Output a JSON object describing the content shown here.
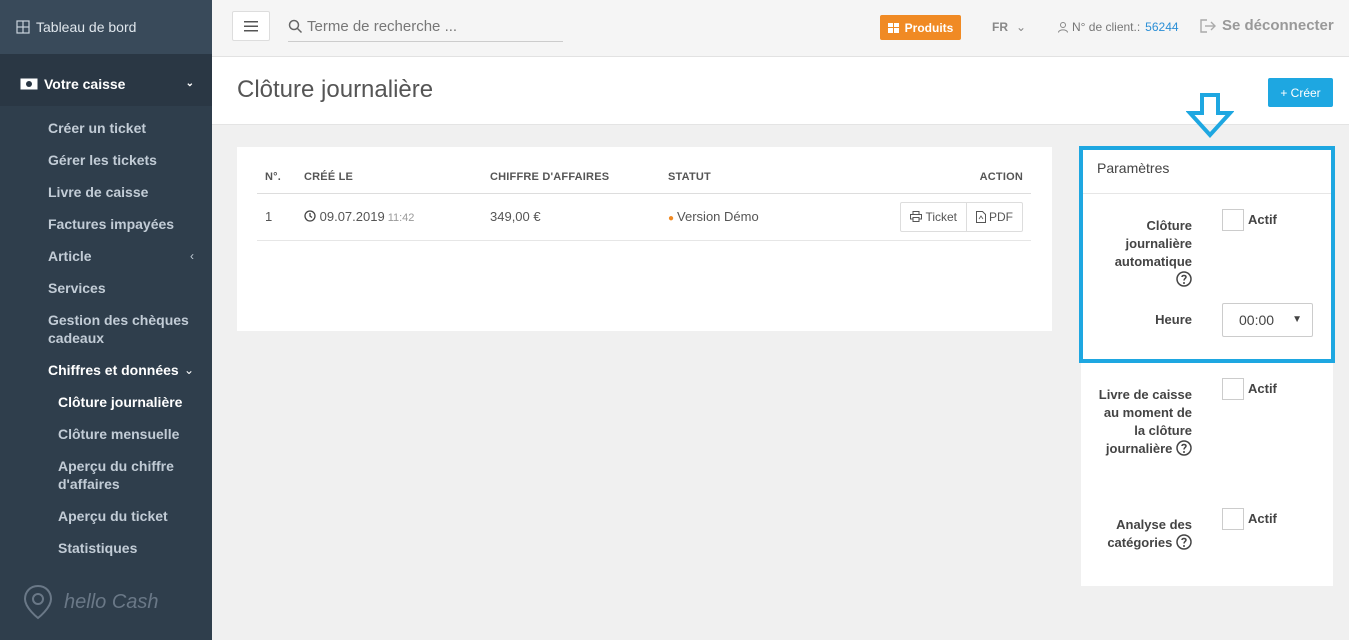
{
  "sidebar": {
    "dashboard_label": "Tableau de bord",
    "section_label": "Votre caisse",
    "items": [
      {
        "label": "Créer un ticket"
      },
      {
        "label": "Gérer les tickets"
      },
      {
        "label": "Livre de caisse"
      },
      {
        "label": "Factures impayées"
      },
      {
        "label": "Article"
      },
      {
        "label": "Services"
      },
      {
        "label": "Gestion des chèques cadeaux"
      },
      {
        "label": "Chiffres et données"
      }
    ],
    "subitems": [
      {
        "label": "Clôture journalière"
      },
      {
        "label": "Clôture mensuelle"
      },
      {
        "label": "Aperçu du chiffre d'affaires"
      },
      {
        "label": "Aperçu du ticket"
      },
      {
        "label": "Statistiques"
      }
    ],
    "logo_text": "hello Cash"
  },
  "topbar": {
    "search_placeholder": "Terme de recherche ...",
    "products_label": "Produits",
    "language": "FR",
    "client_label": "N° de client.:",
    "client_number": "56244",
    "logout_label": "Se déconnecter"
  },
  "page": {
    "title": "Clôture journalière",
    "create_label": "+ Créer"
  },
  "table": {
    "headers": [
      "N°.",
      "CRÉÉ LE",
      "CHIFFRE D'AFFAIRES",
      "STATUT",
      "ACTION"
    ],
    "rows": [
      {
        "num": "1",
        "date": "09.07.2019",
        "time": "11:42",
        "revenue": "349,00 €",
        "status": "Version Démo",
        "ticket_label": "Ticket",
        "pdf_label": "PDF"
      }
    ]
  },
  "params": {
    "title": "Paramètres",
    "auto_close_label": "Clôture journalière automatique",
    "auto_close_checkbox": "Actif",
    "hour_label": "Heure",
    "hour_value": "00:00",
    "cashbook_label": "Livre de caisse au moment de la clôture journalière",
    "cashbook_checkbox": "Actif",
    "categories_label": "Analyse des catégories",
    "categories_checkbox": "Actif"
  },
  "colors": {
    "accent": "#1ea7e1",
    "products": "#f08a24",
    "sidebar": "#2f3e4c"
  }
}
